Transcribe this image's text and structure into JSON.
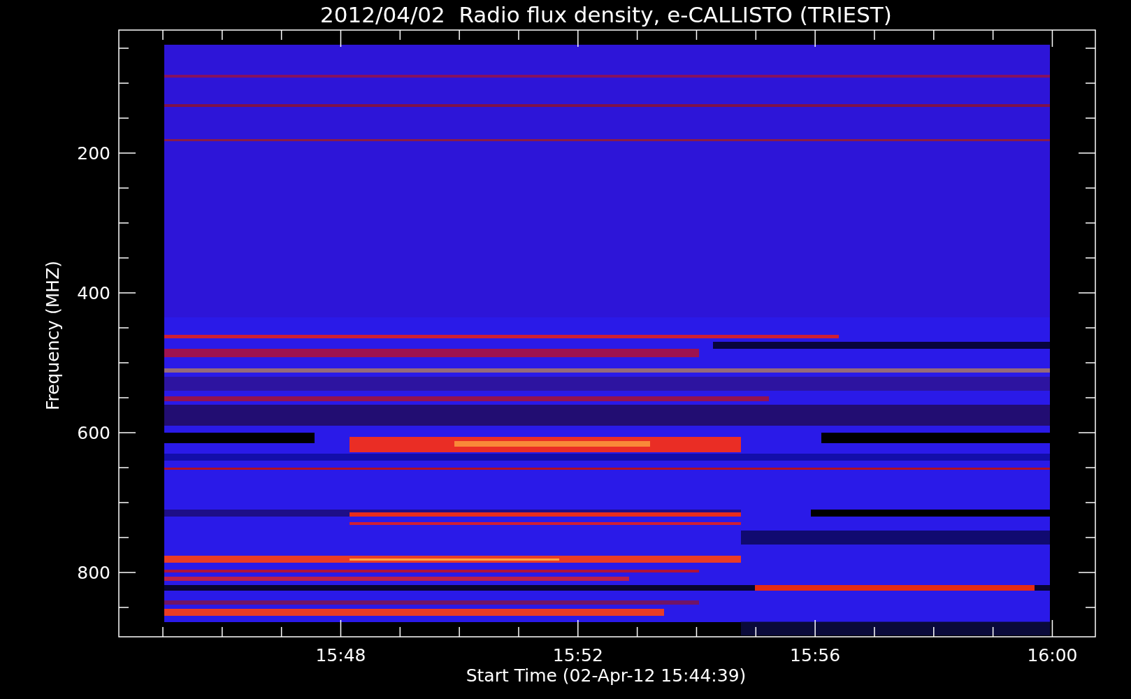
{
  "title": "2012/04/02  Radio flux density, e-CALLISTO (TRIEST)",
  "plot": {
    "ylabel": "Frequency (MHZ)",
    "xlabel": "Start Time (02-Apr-12 15:44:39)",
    "yticks": [
      "200",
      "400",
      "600",
      "800"
    ],
    "xticks": [
      "15:48",
      "15:52",
      "15:56",
      "16:00"
    ]
  }
}
